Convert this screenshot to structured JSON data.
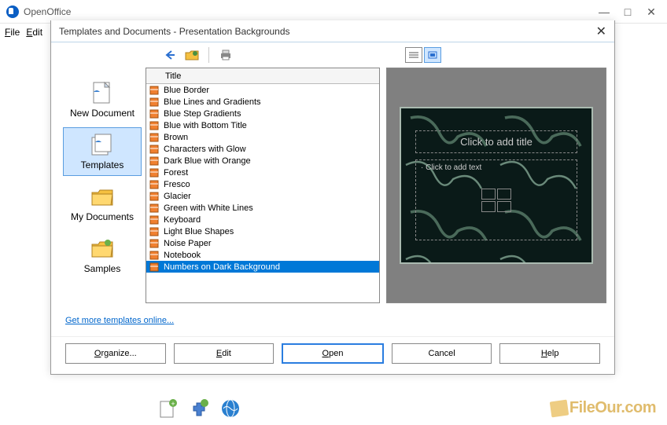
{
  "app": {
    "title": "OpenOffice"
  },
  "menubar": {
    "file": "File",
    "edit": "Edit"
  },
  "dialog": {
    "title": "Templates and Documents - Presentation Backgrounds",
    "sidebar": [
      {
        "label": "New Document"
      },
      {
        "label": "Templates"
      },
      {
        "label": "My Documents"
      },
      {
        "label": "Samples"
      }
    ],
    "list": {
      "header": "Title",
      "items": [
        "Blue Border",
        "Blue Lines and Gradients",
        "Blue Step Gradients",
        "Blue with Bottom Title",
        "Brown",
        "Characters with Glow",
        "Dark Blue with Orange",
        "Forest",
        "Fresco",
        "Glacier",
        "Green with White Lines",
        "Keyboard",
        "Light Blue Shapes",
        "Noise Paper",
        "Notebook",
        "Numbers on Dark Background"
      ],
      "selected_index": 15
    },
    "preview": {
      "title_placeholder": "Click to add title",
      "text_placeholder": "Click to add text"
    },
    "link": "Get more templates online...",
    "buttons": {
      "organize": "Organize...",
      "edit": "Edit",
      "open": "Open",
      "cancel": "Cancel",
      "help": "Help"
    }
  },
  "watermark": "FileOur.com"
}
